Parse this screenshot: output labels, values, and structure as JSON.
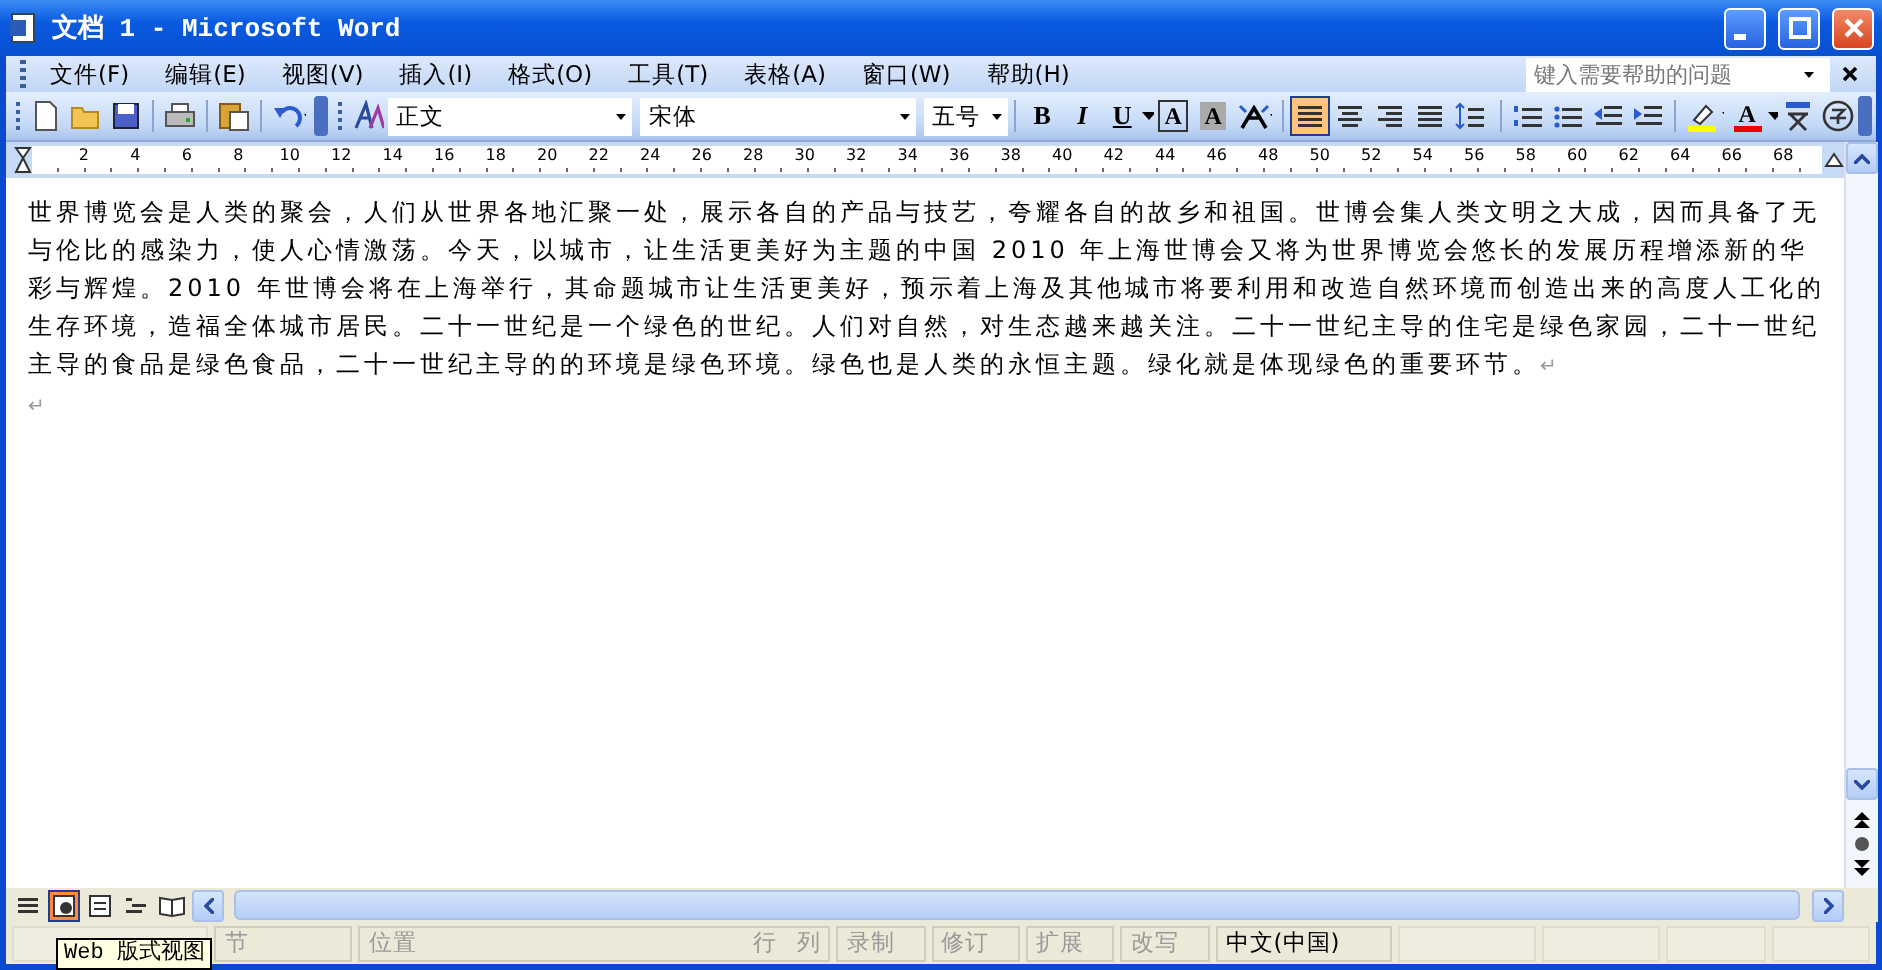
{
  "window": {
    "title": "文档 1 - Microsoft Word"
  },
  "menu": [
    "文件(F)",
    "编辑(E)",
    "视图(V)",
    "插入(I)",
    "格式(O)",
    "工具(T)",
    "表格(A)",
    "窗口(W)",
    "帮助(H)"
  ],
  "help_box": {
    "placeholder": "键入需要帮助的问题"
  },
  "toolbar": {
    "style": "正文",
    "font": "宋体",
    "size": "五号",
    "format_buttons": [
      "B",
      "I",
      "U"
    ],
    "char_buttons": [
      "A",
      "A"
    ],
    "font_color_button": "A",
    "align_buttons": [
      {
        "selected": true
      },
      {
        "selected": false
      },
      {
        "selected": false
      },
      {
        "selected": false
      }
    ]
  },
  "ruler": {
    "labels": [
      "2",
      "4",
      "6",
      "8",
      "10",
      "12",
      "14",
      "16",
      "18",
      "20",
      "22",
      "24",
      "26",
      "28",
      "30",
      "32",
      "34",
      "36",
      "38",
      "40",
      "42",
      "44",
      "46",
      "48",
      "50",
      "52",
      "54",
      "56",
      "58",
      "60",
      "62",
      "64",
      "66",
      "68"
    ]
  },
  "document": {
    "paragraphs": [
      {
        "text": "世界博览会是人类的聚会，人们从世界各地汇聚一处，展示各自的产品与技艺，夸耀各自的故乡和祖国。世博会集人类文明之大成，因而具备了无与伦比的感染力，使人心情激荡。今天，以城市，让生活更美好为主题的中国 2010 年上海世博会又将为世界博览会悠长的发展历程增添新的华彩与辉煌。2010 年世博会将在上海举行，其命题城市让生活更美好，预示着上海及其他城市将要利用和改造自然环境而创造出来的高度人工化的生存环境，造福全体城市居民。二十一世纪是一个绿色的世纪。人们对自然，对生态越来越关注。二十一世纪主导的住宅是绿色家园，二十一世纪主导的食品是绿色食品，二十一世纪主导的的环境是绿色环境。绿色也是人类的永恒主题。绿化就是体现绿色的重要环节。",
        "mark": "↵"
      },
      {
        "mark": "↵"
      }
    ]
  },
  "view_buttons": [
    {
      "kind": "normal",
      "selected": false
    },
    {
      "kind": "web",
      "selected": true
    },
    {
      "kind": "print",
      "selected": false
    },
    {
      "kind": "outline",
      "selected": false
    },
    {
      "kind": "reading",
      "selected": false
    }
  ],
  "tooltip": "Web 版式视图",
  "status_bar": [
    {
      "kind": "blank"
    },
    {
      "texts": [
        "节"
      ],
      "dimmed": true
    },
    {
      "texts": [
        "位置",
        "行",
        "列"
      ],
      "dimmed": true
    },
    {
      "texts": [
        "录制"
      ],
      "dimmed": true
    },
    {
      "texts": [
        "修订"
      ],
      "dimmed": true
    },
    {
      "texts": [
        "扩展"
      ],
      "dimmed": true
    },
    {
      "texts": [
        "改写"
      ],
      "dimmed": true
    },
    {
      "texts": [
        "中文(中国)"
      ],
      "dimmed": false
    },
    {
      "kind": "blank"
    },
    {
      "kind": "blank"
    },
    {
      "kind": "blank"
    },
    {
      "kind": "blank"
    }
  ]
}
